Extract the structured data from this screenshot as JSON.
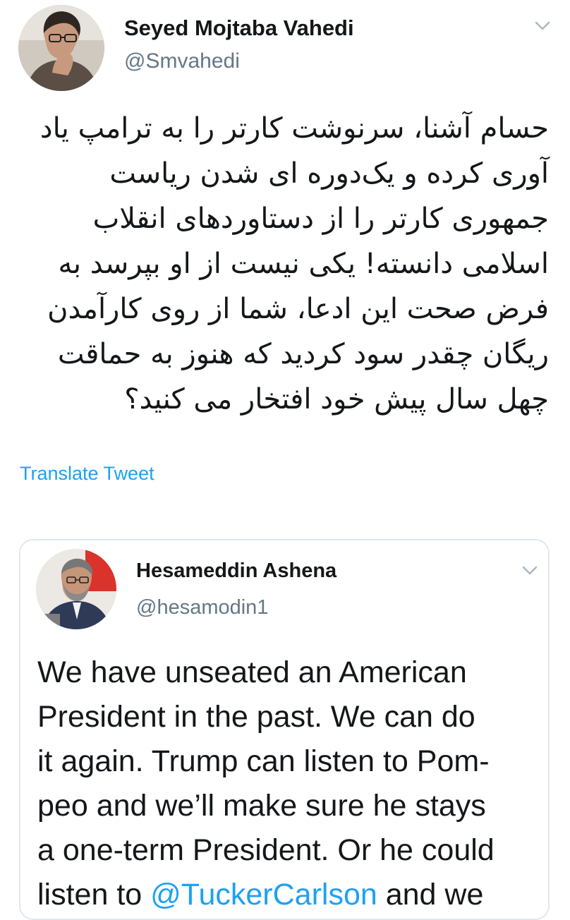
{
  "tweet": {
    "author_name": "Seyed Mojtaba Vahedi",
    "author_handle": "@Smvahedi",
    "body": "حسام آشنا، سرنوشت کارتر را به ترامپ یاد آوری کرده و یک‌دوره ای شدن ریاست جمهوری کارتر را از دستاوردهای انقلاب اسلامی دانسته! یکی نیست از او بپرسد به فرض صحت این ادعا، شما از روی کارآمدن ریگان چقدر سود کردید که هنوز به حماقت چهل سال پیش خود افتخار می کنید؟",
    "translate_label": "Translate Tweet",
    "menu_icon": "chevron-down-icon"
  },
  "quoted": {
    "author_name": "Hesameddin Ashena",
    "author_handle": "@hesamodin1",
    "menu_icon": "chevron-down-icon",
    "lines": [
      "We have unseated an American",
      "President in the past. We can do",
      "it again. Trump can listen to Pom-",
      "peo and we’ll make sure he stays",
      "a one-term President. Or he could"
    ],
    "last_line": {
      "before": "listen to ",
      "mention": "@TuckerCarlson",
      "after": " and we"
    }
  },
  "colors": {
    "link": "#1da1f2",
    "secondary_text": "#657786",
    "card_border": "#e1e8ed"
  }
}
